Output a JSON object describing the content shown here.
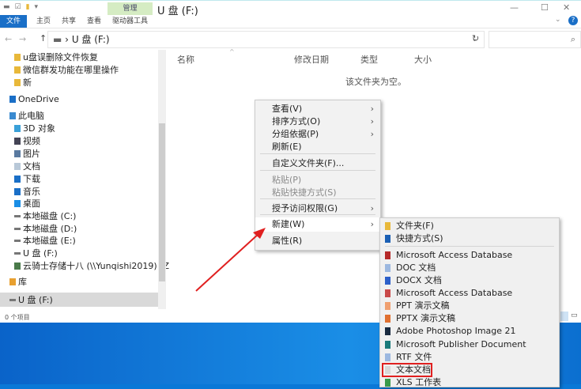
{
  "window": {
    "title": "U 盘 (F:)",
    "ribbon_tabs": [
      "文件",
      "主页",
      "共享",
      "查看"
    ],
    "context_tab_group": "管理",
    "context_tab": "驱动器工具",
    "minimize": "—",
    "maximize": "☐",
    "close": "✕"
  },
  "address": {
    "path": "U 盘 (F:)",
    "separator": "›",
    "back": "←",
    "forward": "→",
    "up": "↑",
    "dropdown": "⌄",
    "refresh": "↻",
    "search_icon": "⌕"
  },
  "nav": {
    "items": [
      {
        "label": "u盘误删除文件恢复",
        "icon": "folder-icon"
      },
      {
        "label": "微信群发功能在哪里操作",
        "icon": "folder-icon"
      },
      {
        "label": "新",
        "icon": "folder-icon"
      },
      {
        "label": "OneDrive",
        "icon": "cloud-icon"
      },
      {
        "label": "此电脑",
        "icon": "computer-icon"
      },
      {
        "label": "3D 对象",
        "icon": "cube-icon"
      },
      {
        "label": "视频",
        "icon": "video-icon"
      },
      {
        "label": "图片",
        "icon": "picture-icon"
      },
      {
        "label": "文档",
        "icon": "document-icon"
      },
      {
        "label": "下载",
        "icon": "download-icon"
      },
      {
        "label": "音乐",
        "icon": "music-icon"
      },
      {
        "label": "桌面",
        "icon": "desktop-icon"
      },
      {
        "label": "本地磁盘 (C:)",
        "icon": "drive-icon"
      },
      {
        "label": "本地磁盘 (D:)",
        "icon": "drive-icon"
      },
      {
        "label": "本地磁盘 (E:)",
        "icon": "drive-icon"
      },
      {
        "label": "U 盘 (F:)",
        "icon": "drive-icon"
      },
      {
        "label": "云骑士存储十八 (\\\\Yunqishi2019) (Z",
        "icon": "network-drive-icon"
      },
      {
        "label": "库",
        "icon": "library-icon"
      },
      {
        "label": "U 盘 (F:)",
        "icon": "drive-icon"
      }
    ]
  },
  "columns": [
    "名称",
    "修改日期",
    "类型",
    "大小"
  ],
  "empty_message": "该文件夹为空。",
  "status": "0 个项目",
  "context_menu": {
    "items": [
      {
        "label": "查看(V)",
        "sub": true
      },
      {
        "label": "排序方式(O)",
        "sub": true
      },
      {
        "label": "分组依据(P)",
        "sub": true
      },
      {
        "label": "刷新(E)"
      },
      {
        "label": "自定义文件夹(F)..."
      },
      {
        "label": "粘贴(P)",
        "disabled": true
      },
      {
        "label": "粘贴快捷方式(S)",
        "disabled": true
      },
      {
        "label": "授予访问权限(G)",
        "sub": true
      },
      {
        "label": "新建(W)",
        "sub": true,
        "highlighted": true
      },
      {
        "label": "属性(R)"
      }
    ],
    "arrow": "›"
  },
  "new_submenu": {
    "items": [
      {
        "label": "文件夹(F)",
        "color": "#e8b83a"
      },
      {
        "label": "快捷方式(S)",
        "color": "#1a5fb4"
      },
      {
        "label": "Microsoft Access Database",
        "color": "#b52a2a"
      },
      {
        "label": "DOC 文档",
        "color": "#9cb8e0"
      },
      {
        "label": "DOCX 文档",
        "color": "#2b5fc9"
      },
      {
        "label": "Microsoft Access Database",
        "color": "#c94a4a"
      },
      {
        "label": "PPT 演示文稿",
        "color": "#f0a070"
      },
      {
        "label": "PPTX 演示文稿",
        "color": "#e07030"
      },
      {
        "label": "Adobe Photoshop Image 21",
        "color": "#1a2a40"
      },
      {
        "label": "Microsoft Publisher Document",
        "color": "#1a7a7a"
      },
      {
        "label": "RTF 文件",
        "color": "#9cb8e0"
      },
      {
        "label": "文本文档",
        "color": "#d8d8d8",
        "boxed": true
      },
      {
        "label": "XLS 工作表",
        "color": "#3a9a4a"
      }
    ]
  },
  "accent": "#1a6fc7",
  "annotation_color": "#e02020"
}
